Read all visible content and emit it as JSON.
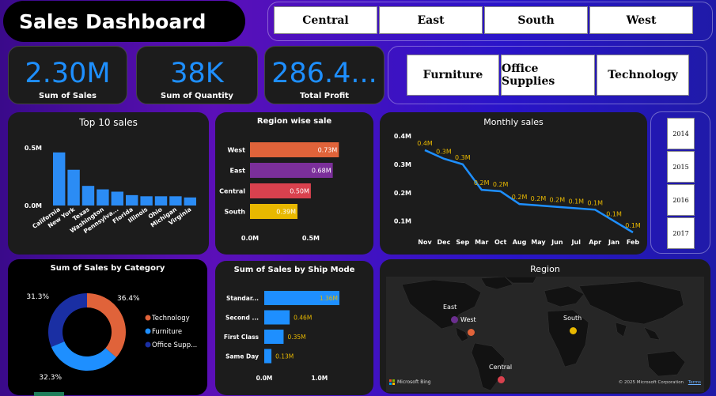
{
  "dashboard": {
    "title": "Sales Dashboard"
  },
  "region_slicer": [
    "Central",
    "East",
    "South",
    "West"
  ],
  "category_slicer": [
    "Furniture",
    "Office Supplies",
    "Technology"
  ],
  "year_slicer": [
    "2014",
    "2015",
    "2016",
    "2017"
  ],
  "kpis": [
    {
      "value": "2.30M",
      "label": "Sum of Sales"
    },
    {
      "value": "38K",
      "label": "Sum of Quantity"
    },
    {
      "value": "286.4...",
      "label": "Total Profit"
    }
  ],
  "panels": {
    "top10": "Top 10 sales",
    "region_sale": "Region wise sale",
    "monthly": "Monthly sales",
    "category": "Sum of Sales by Category",
    "shipmode": "Sum of Sales by Ship Mode",
    "map": "Region"
  },
  "map": {
    "markers": [
      {
        "name": "East",
        "color": "#6b2f8f"
      },
      {
        "name": "West",
        "color": "#e0633a"
      },
      {
        "name": "South",
        "color": "#e8b800"
      },
      {
        "name": "Central",
        "color": "#d9414e"
      }
    ],
    "attribution_left": "Microsoft Bing",
    "attribution_right": "© 2025 Microsoft Corporation",
    "terms": "Terms"
  },
  "chart_data": [
    {
      "type": "bar",
      "title": "Top 10 sales",
      "categories": [
        "California",
        "New York",
        "Texas",
        "Washington",
        "Pennsylva...",
        "Florida",
        "Illinois",
        "Ohio",
        "Michigan",
        "Virginia"
      ],
      "values": [
        0.46,
        0.31,
        0.17,
        0.14,
        0.12,
        0.09,
        0.08,
        0.08,
        0.08,
        0.07
      ],
      "ytick_labels": [
        "0.0M",
        "0.5M"
      ],
      "ylim": [
        0,
        0.5
      ],
      "color": "#2b8cf5"
    },
    {
      "type": "bar",
      "orientation": "horizontal",
      "title": "Region wise sale",
      "categories": [
        "West",
        "East",
        "Central",
        "South"
      ],
      "values": [
        0.73,
        0.68,
        0.5,
        0.39
      ],
      "data_labels": [
        "0.73M",
        "0.68M",
        "0.50M",
        "0.39M"
      ],
      "colors": [
        "#e0633a",
        "#7b2f9a",
        "#d9414e",
        "#e8b800"
      ],
      "xtick_labels": [
        "0.0M",
        "0.5M"
      ],
      "xlim": [
        0,
        0.78
      ]
    },
    {
      "type": "line",
      "title": "Monthly sales",
      "categories": [
        "Nov",
        "Dec",
        "Sep",
        "Mar",
        "Oct",
        "Aug",
        "May",
        "Jun",
        "Jul",
        "Apr",
        "Jan",
        "Feb"
      ],
      "values": [
        0.35,
        0.32,
        0.3,
        0.21,
        0.205,
        0.16,
        0.155,
        0.15,
        0.145,
        0.14,
        0.1,
        0.06
      ],
      "data_labels": [
        "0.4M",
        "0.3M",
        "0.3M",
        "0.2M",
        "0.2M",
        "0.2M",
        "0.2M",
        "0.2M",
        "0.1M",
        "0.1M",
        "0.1M",
        "0.1M"
      ],
      "ytick_labels": [
        "0.1M",
        "0.2M",
        "0.3M",
        "0.4M"
      ],
      "ylim": [
        0.06,
        0.4
      ],
      "color": "#1e8fff"
    },
    {
      "type": "pie",
      "title": "Sum of Sales by Category",
      "categories": [
        "Technology",
        "Furniture",
        "Office Supp..."
      ],
      "values": [
        36.4,
        32.3,
        31.3
      ],
      "data_labels": [
        "36.4%",
        "32.3%",
        "31.3%"
      ],
      "colors": [
        "#e0633a",
        "#1e8fff",
        "#1a2fa3"
      ]
    },
    {
      "type": "bar",
      "orientation": "horizontal",
      "title": "Sum of Sales by Ship Mode",
      "categories": [
        "Standar...",
        "Second ...",
        "First Class",
        "Same Day"
      ],
      "values": [
        1.36,
        0.46,
        0.35,
        0.13
      ],
      "data_labels": [
        "1.36M",
        "0.46M",
        "0.35M",
        "0.13M"
      ],
      "xtick_labels": [
        "0.0M",
        "1.0M"
      ],
      "xlim": [
        0,
        1.36
      ],
      "color": "#1e8fff"
    }
  ]
}
